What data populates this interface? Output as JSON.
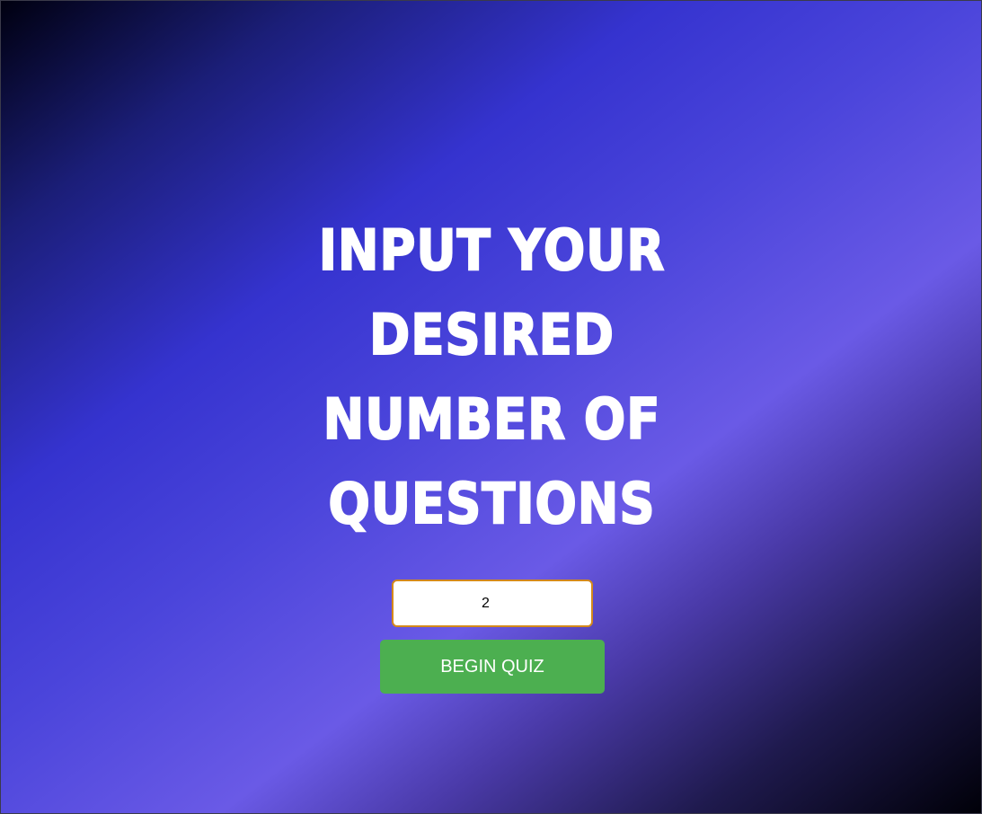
{
  "heading": {
    "line1": "INPUT YOUR",
    "line2": "DESIRED",
    "line3": "NUMBER OF",
    "line4": "QUESTIONS"
  },
  "question_count_input": {
    "value": "2"
  },
  "begin_button": {
    "label": "BEGIN QUIZ"
  },
  "colors": {
    "button": "#4caf50",
    "input_border": "#d4891c",
    "gradient_main": "#3533cf",
    "gradient_light": "#6a5ae6"
  }
}
